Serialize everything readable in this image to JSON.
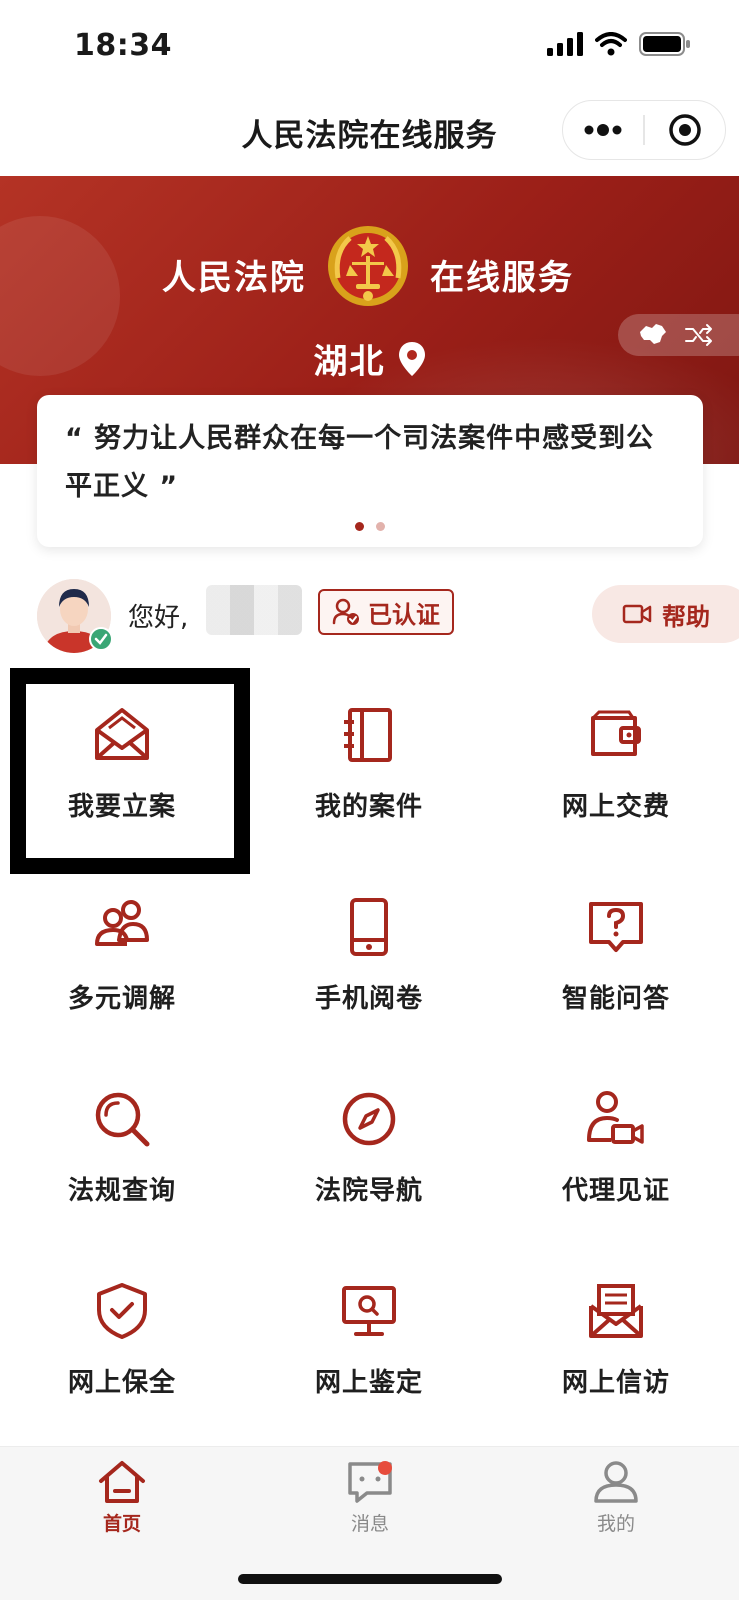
{
  "status": {
    "time": "18:34"
  },
  "title_bar": {
    "title": "人民法院在线服务"
  },
  "banner": {
    "left_text": "人民法院",
    "right_text": "在线服务",
    "region": "湖北",
    "quote": "“ 努力让人民群众在每一个司法案件中感受到公平正义 ”",
    "carousel_pages": 2,
    "carousel_active": 1
  },
  "user": {
    "greeting": "您好,",
    "verified_label": "已认证",
    "help_label": "帮助"
  },
  "services": [
    {
      "label": "我要立案",
      "icon": "envelope-open-icon"
    },
    {
      "label": "我的案件",
      "icon": "notebook-icon"
    },
    {
      "label": "网上交费",
      "icon": "wallet-icon"
    },
    {
      "label": "多元调解",
      "icon": "people-icon"
    },
    {
      "label": "手机阅卷",
      "icon": "mobile-icon"
    },
    {
      "label": "智能问答",
      "icon": "question-bubble-icon"
    },
    {
      "label": "法规查询",
      "icon": "search-icon"
    },
    {
      "label": "法院导航",
      "icon": "compass-icon"
    },
    {
      "label": "代理见证",
      "icon": "person-video-icon"
    },
    {
      "label": "网上保全",
      "icon": "shield-check-icon"
    },
    {
      "label": "网上鉴定",
      "icon": "monitor-search-icon"
    },
    {
      "label": "网上信访",
      "icon": "mail-letter-icon"
    }
  ],
  "tabs": [
    {
      "label": "首页",
      "icon": "home-icon",
      "active": true
    },
    {
      "label": "消息",
      "icon": "message-icon",
      "active": false,
      "has_badge": true
    },
    {
      "label": "我的",
      "icon": "profile-icon",
      "active": false
    }
  ],
  "colors": {
    "brand": "#a5271d",
    "banner": "#9b1f18",
    "badge": "#e74c3c",
    "verified": "#3aa675"
  }
}
